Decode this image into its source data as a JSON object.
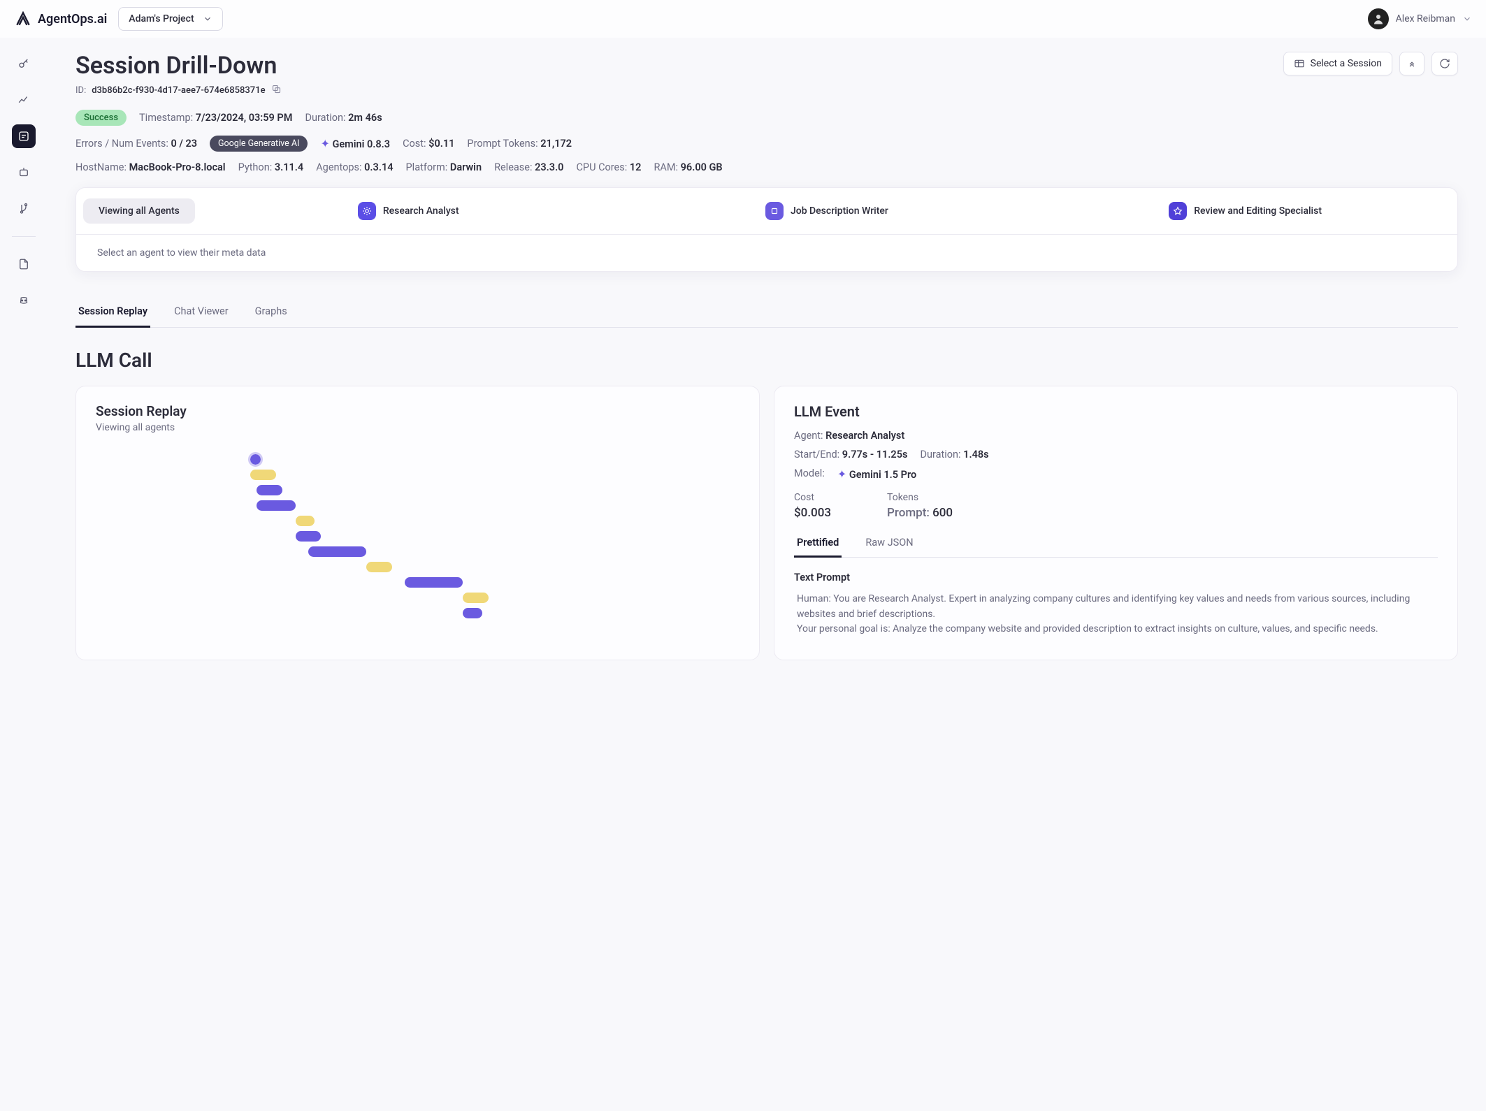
{
  "brand": "AgentOps.ai",
  "project_selector": "Adam's Project",
  "user_name": "Alex Reibman",
  "page": {
    "title": "Session Drill-Down",
    "id_label": "ID:",
    "id_value": "d3b86b2c-f930-4d17-aee7-674e6858371e"
  },
  "actions": {
    "select_session": "Select a Session"
  },
  "status_badge": "Success",
  "meta": {
    "timestamp_label": "Timestamp:",
    "timestamp": "7/23/2024, 03:59 PM",
    "duration_label": "Duration:",
    "duration": "2m 46s",
    "errors_label": "Errors / Num Events:",
    "errors": "0 / 23",
    "provider_pill": "Google Generative AI",
    "model_badge": "Gemini 0.8.3",
    "cost_label": "Cost:",
    "cost": "$0.11",
    "prompt_tokens_label": "Prompt Tokens:",
    "prompt_tokens": "21,172",
    "hostname_label": "HostName:",
    "hostname": "MacBook-Pro-8.local",
    "python_label": "Python:",
    "python": "3.11.4",
    "agentops_label": "Agentops:",
    "agentops": "0.3.14",
    "platform_label": "Platform:",
    "platform": "Darwin",
    "release_label": "Release:",
    "release": "23.3.0",
    "cpu_label": "CPU Cores:",
    "cpu": "12",
    "ram_label": "RAM:",
    "ram": "96.00 GB"
  },
  "agents": {
    "all": "Viewing all Agents",
    "items": [
      "Research Analyst",
      "Job Description Writer",
      "Review and Editing Specialist"
    ],
    "hint": "Select an agent to view their meta data"
  },
  "tabs": [
    "Session Replay",
    "Chat Viewer",
    "Graphs"
  ],
  "section_heading": "LLM Call",
  "replay": {
    "title": "Session Replay",
    "sub": "Viewing all agents"
  },
  "event": {
    "title": "LLM Event",
    "agent_label": "Agent:",
    "agent": "Research Analyst",
    "startend_label": "Start/End:",
    "startend": "9.77s - 11.25s",
    "duration_label": "Duration:",
    "duration": "1.48s",
    "model_label": "Model:",
    "model": "Gemini 1.5 Pro",
    "cost_label": "Cost",
    "cost": "$0.003",
    "tokens_label": "Tokens",
    "prompt_tokens_label": "Prompt:",
    "prompt_tokens": "600",
    "tabs": [
      "Prettified",
      "Raw JSON"
    ],
    "prompt_heading": "Text Prompt",
    "prompt_body_1": "Human: You are Research Analyst. Expert in analyzing company cultures and identifying key values and needs from various sources, including websites and brief descriptions.",
    "prompt_body_2": "Your personal goal is: Analyze the company website and provided description to extract insights on culture, values, and specific needs."
  },
  "chart_data": {
    "type": "gantt",
    "title": "Session Replay",
    "rows": [
      {
        "start": 24,
        "width": 3,
        "color": "purple",
        "selected": true
      },
      {
        "start": 24,
        "width": 4,
        "color": "yellow"
      },
      {
        "start": 25,
        "width": 4,
        "color": "purple"
      },
      {
        "start": 25,
        "width": 6,
        "color": "purple"
      },
      {
        "start": 31,
        "width": 3,
        "color": "yellow"
      },
      {
        "start": 31,
        "width": 4,
        "color": "purple"
      },
      {
        "start": 33,
        "width": 9,
        "color": "purple"
      },
      {
        "start": 42,
        "width": 4,
        "color": "yellow"
      },
      {
        "start": 48,
        "width": 9,
        "color": "purple"
      },
      {
        "start": 57,
        "width": 4,
        "color": "yellow"
      },
      {
        "start": 57,
        "width": 3,
        "color": "purple"
      }
    ]
  }
}
